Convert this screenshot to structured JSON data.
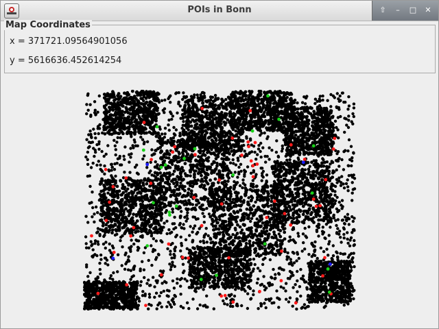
{
  "window": {
    "title": "POIs in Bonn"
  },
  "icons": {
    "app": "java-app-icon",
    "minimize": "minimize-icon",
    "restore": "restore-icon",
    "maximize": "maximize-icon",
    "close": "close-icon"
  },
  "panel": {
    "legend": "Map Coordinates",
    "x_line": "x = 371721.09564901056",
    "y_line": "y = 5616636.452614254"
  },
  "map": {
    "colors": {
      "poi": "#000000",
      "red": "#ff1a1a",
      "green": "#18d018",
      "blue": "#1a1aff"
    }
  }
}
